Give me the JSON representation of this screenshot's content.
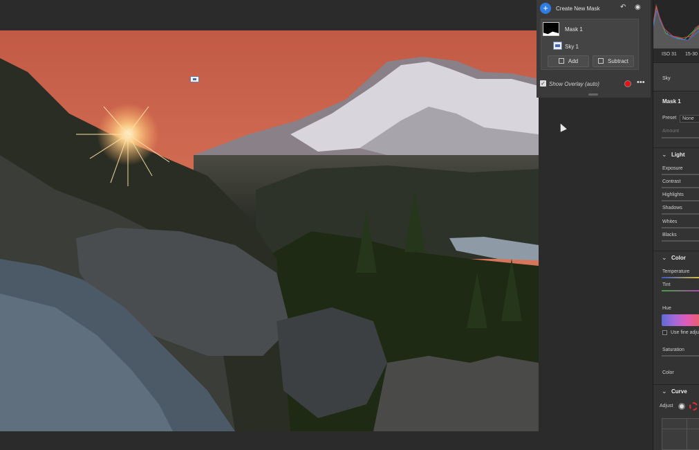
{
  "mask_panel": {
    "create_label": "Create New Mask",
    "masks": [
      {
        "label": "Mask 1"
      },
      {
        "label": "Sky 1"
      }
    ],
    "add_label": "Add",
    "subtract_label": "Subtract",
    "overlay_label": "Show Overlay (auto)",
    "overlay_checked": true,
    "overlay_color": "#e41414"
  },
  "tools": {
    "iso": "ISO 31",
    "lens": "15-30",
    "tool_name": "Sky",
    "mask_name": "Mask 1",
    "preset_label": "Preset",
    "preset_value": "None",
    "amount_label": "Amount",
    "light": {
      "title": "Light",
      "items": [
        "Exposure",
        "Contrast",
        "Highlights",
        "Shadows",
        "Whites",
        "Blacks"
      ]
    },
    "color": {
      "title": "Color",
      "items": [
        "Temperature",
        "Tint"
      ],
      "hue_label": "Hue",
      "fine_adjust_label": "Use fine adju",
      "saturation_label": "Saturation",
      "color_label": "Color"
    },
    "curve": {
      "title": "Curve",
      "adjust_label": "Adjust"
    }
  },
  "colors": {
    "accent": "#2f7de1",
    "panel": "#3a3a3a",
    "background": "#2b2b2b"
  },
  "icons": [
    "plus-icon",
    "undo-icon",
    "eye-icon",
    "more-icon",
    "chevron-down-icon",
    "cursor-arrow"
  ]
}
